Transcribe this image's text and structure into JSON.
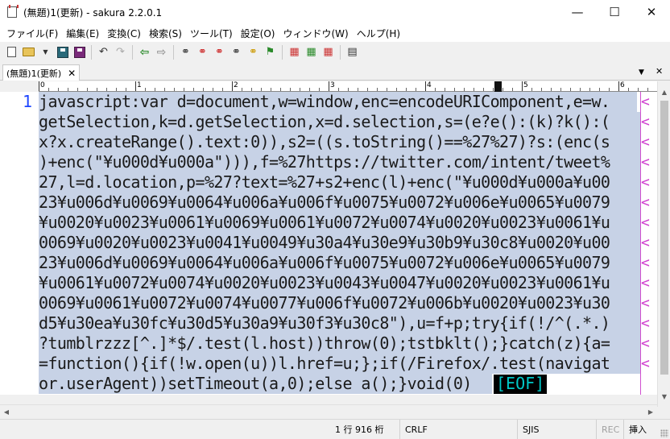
{
  "window": {
    "title": "(無題)1(更新) - sakura 2.2.0.1",
    "minimize": "—",
    "maximize": "☐",
    "close": "✕"
  },
  "menu": [
    "ファイル(F)",
    "編集(E)",
    "変換(C)",
    "検索(S)",
    "ツール(T)",
    "設定(O)",
    "ウィンドウ(W)",
    "ヘルプ(H)"
  ],
  "tab": {
    "label": "(無題)1(更新)",
    "close": "✕"
  },
  "tab_controls": {
    "dropdown": "▼",
    "close": "✕"
  },
  "ruler": {
    "labels": [
      "0",
      "1",
      "2",
      "3",
      "4",
      "5",
      "6"
    ]
  },
  "editor": {
    "line_number": "1",
    "lines": [
      "javascript:var d=document,w=window,enc=encodeURIComponent,e=w.",
      "getSelection,k=d.getSelection,x=d.selection,s=(e?e():(k)?k():(",
      "x?x.createRange().text:0)),s2=((s.toString()==%27%27)?s:(enc(s",
      ")+enc(\"¥u000d¥u000a\"))),f=%27https://twitter.com/intent/tweet%",
      "27,l=d.location,p=%27?text=%27+s2+enc(l)+enc(\"¥u000d¥u000a¥u00",
      "23¥u006d¥u0069¥u0064¥u006a¥u006f¥u0075¥u0072¥u006e¥u0065¥u0079",
      "¥u0020¥u0023¥u0061¥u0069¥u0061¥u0072¥u0074¥u0020¥u0023¥u0061¥u",
      "0069¥u0020¥u0023¥u0041¥u0049¥u30a4¥u30e9¥u30b9¥u30c8¥u0020¥u00",
      "23¥u006d¥u0069¥u0064¥u006a¥u006f¥u0075¥u0072¥u006e¥u0065¥u0079",
      "¥u0061¥u0072¥u0074¥u0020¥u0023¥u0043¥u0047¥u0020¥u0023¥u0061¥u",
      "0069¥u0061¥u0072¥u0074¥u0077¥u006f¥u0072¥u006b¥u0020¥u0023¥u30",
      "d5¥u30ea¥u30fc¥u30d5¥u30a9¥u30f3¥u30c8\"),u=f+p;try{if(!/^(.*.)",
      "?tumblrzzz[^.]*$/.test(l.host))throw(0);tstbklt();}catch(z){a=",
      "=function(){if(!w.open(u))l.href=u;};if(/Firefox/.test(navigat",
      "or.userAgent))setTimeout(a,0);else a();}void(0)"
    ],
    "wrap_mark": "<",
    "eof": "[EOF]"
  },
  "scroll": {
    "up": "▲",
    "down": "▼",
    "left": "◀",
    "right": "▶"
  },
  "status": {
    "position": "1 行 916 桁",
    "line_ending": "CRLF",
    "encoding": "SJIS",
    "rec": "REC",
    "mode": "挿入"
  },
  "colors": {
    "selection": "#c7d2e6",
    "line_number": "#1e46ff",
    "wrap_guide": "#d050d0",
    "eof_fg": "#00c8c8"
  }
}
